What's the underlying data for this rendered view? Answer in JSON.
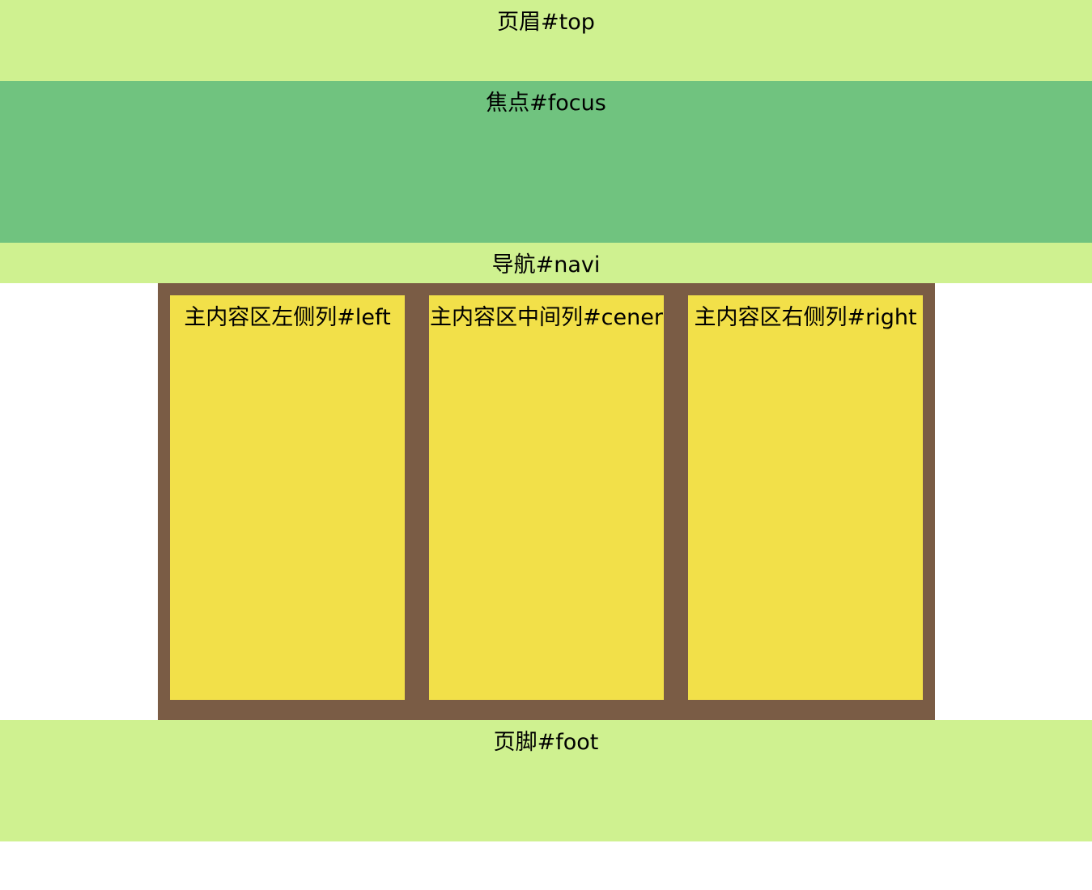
{
  "top": {
    "label": "页眉#top"
  },
  "focus": {
    "label": "焦点#focus"
  },
  "navi": {
    "label": "导航#navi"
  },
  "main": {
    "left": {
      "label": "主内容区左侧列#left"
    },
    "center": {
      "label": "主内容区中间列#cener"
    },
    "right": {
      "label": "主内容区右侧列#right"
    }
  },
  "foot": {
    "label": "页脚#foot"
  },
  "colors": {
    "header_footer_bg": "#cff190",
    "focus_bg": "#70c37f",
    "main_bg": "#7a5c45",
    "column_bg": "#f2e049"
  }
}
